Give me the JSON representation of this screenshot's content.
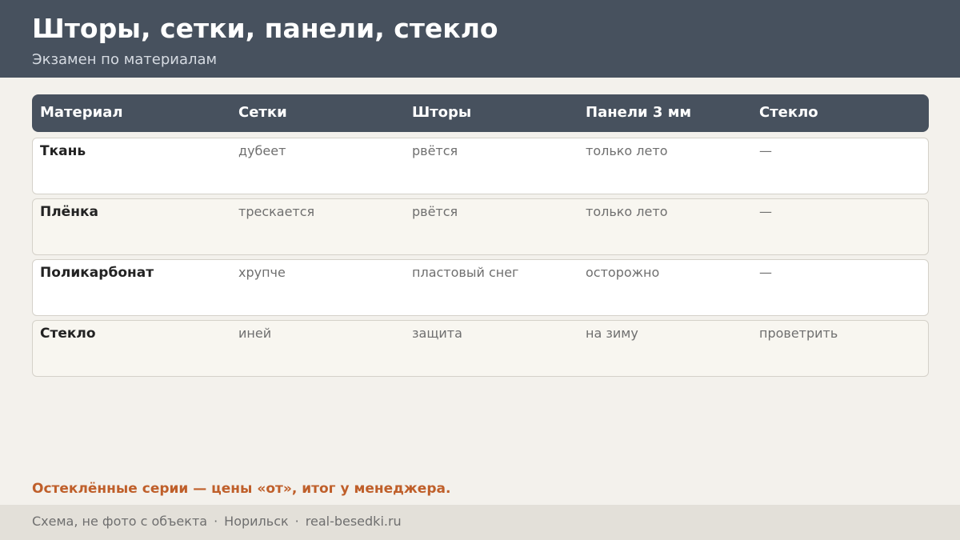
{
  "header": {
    "title": "Шторы, сетки, панели, стекло",
    "subtitle": "Экзамен по материалам"
  },
  "table": {
    "columns": [
      "Материал",
      "Сетки",
      "Шторы",
      "Панели 3 мм",
      "Стекло"
    ],
    "rows": [
      {
        "material": "Ткань",
        "nets": "дубеет",
        "curtains": "рвётся",
        "panels": "только лето",
        "glass": "—"
      },
      {
        "material": "Плёнка",
        "nets": "трескается",
        "curtains": "рвётся",
        "panels": "только лето",
        "glass": "—"
      },
      {
        "material": "Поликарбонат",
        "nets": "хрупче",
        "curtains": "пластовый снег",
        "panels": "осторожно",
        "glass": "—"
      },
      {
        "material": "Стекло",
        "nets": "иней",
        "curtains": "защита",
        "panels": "на зиму",
        "glass": "проветрить"
      }
    ]
  },
  "note": "Остеклённые серии — цены «от», итог у менеджера.",
  "footer": {
    "items": [
      "Схема, не фото с объекта",
      "Норильск",
      "real-besedki.ru"
    ],
    "separator": "·"
  },
  "colors": {
    "header_bg": "#47515e",
    "accent": "#bf5f2a",
    "page_bg": "#f3f1ec",
    "footer_bg": "#e3e0d9"
  }
}
